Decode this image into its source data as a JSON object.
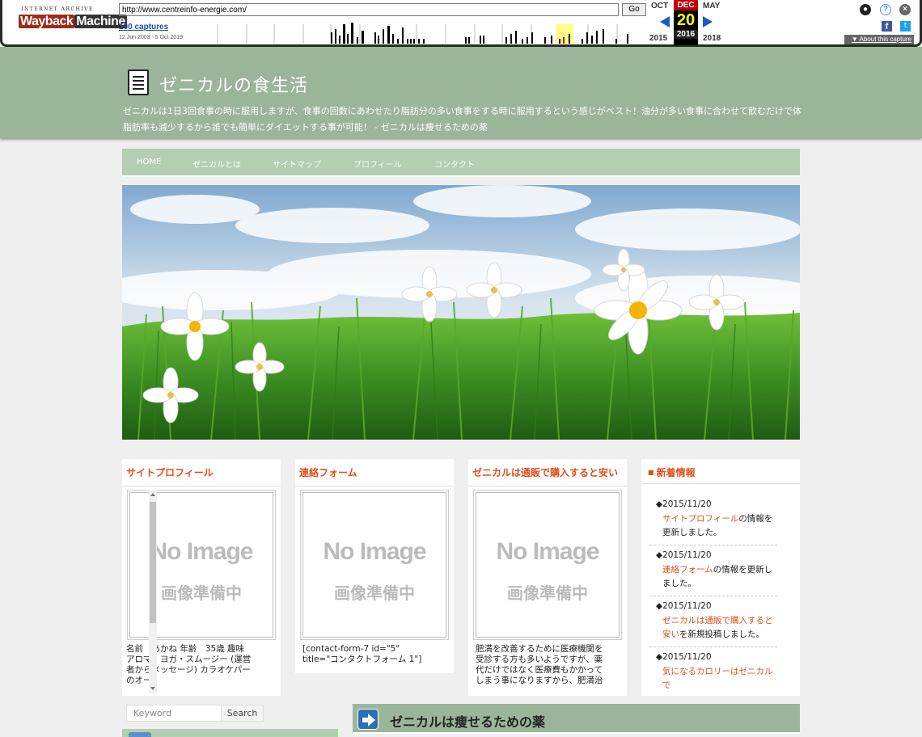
{
  "wayback": {
    "logo_top": "INTERNET ARCHIVE",
    "logo_w1": "Wayback",
    "logo_w2": "Machine",
    "url": "http://www.centreinfo-energie.com/",
    "go": "Go",
    "captures": "100 captures",
    "range": "12 Jun 2003 - 5 Oct 2019",
    "prev_month": "OCT",
    "cur_month": "DEC",
    "next_month": "MAY",
    "cur_day": "20",
    "prev_year": "2015",
    "cur_year": "2016",
    "next_year": "2018",
    "about": "About this capture",
    "help_glyph": "?",
    "close_glyph": "×",
    "fb_glyph": "f",
    "tw_glyph": "t"
  },
  "header": {
    "title": "ゼニカルの食生活",
    "description": "ゼニカルは1日3回食事の時に服用しますが、食事の回数にあわせたり脂肪分の多い食事をする時に服用するという感じがベスト！油分が多い食事に合わせて飲むだけで体脂肪率も減少するから誰でも簡単にダイエットする事が可能！ - ゼニカルは痩せるための薬"
  },
  "nav": [
    {
      "label": "HOME"
    },
    {
      "label": "ゼニカルとは"
    },
    {
      "label": "サイトマップ"
    },
    {
      "label": "プロフィール"
    },
    {
      "label": "コンタクト"
    }
  ],
  "widgets": [
    {
      "title": "サイトプロフィール",
      "noimage": "No Image",
      "noimage_jp": "画像準備中",
      "lines": [
        "名前　あかね 年齢　35歳 趣味",
        "アロマ・ヨガ・スムージー (運営",
        "者からメッセージ) カラオケパー",
        "のオー"
      ]
    },
    {
      "title": "連絡フォーム",
      "noimage": "No Image",
      "noimage_jp": "画像準備中",
      "lines": [
        "[contact-form-7 id=\"5\"",
        "title=\"コンタクトフォーム 1\"]"
      ]
    },
    {
      "title": "ゼニカルは通販で購入すると安い",
      "noimage": "No Image",
      "noimage_jp": "画像準備中",
      "lines": [
        "肥満を改善するために医療機関を",
        "受診する方も多いようですが、薬",
        "代だけではなく医療費もかかって",
        "しまう事になりますから、肥満治"
      ]
    }
  ],
  "news": {
    "title": "新着情報",
    "items": [
      {
        "date": "◆2015/11/20",
        "link": "サイトプロフィール",
        "rest": "の情報を更新しました。"
      },
      {
        "date": "◆2015/11/20",
        "link": "連絡フォーム",
        "rest": "の情報を更新しました。"
      },
      {
        "date": "◆2015/11/20",
        "link": "ゼニカルは通販で購入すると安い",
        "rest": "を新規投稿しました。"
      },
      {
        "date": "◆2015/11/20",
        "link": "気になるカロリーはゼニカルで",
        "rest": ""
      }
    ]
  },
  "search": {
    "placeholder": "Keyword",
    "button": "Search"
  },
  "main": {
    "heading": "ゼニカルは痩せるための薬"
  },
  "colors": {
    "header_bg": "#9bb59a",
    "nav_bg": "#b3ceb1",
    "accent": "#e0501a"
  }
}
